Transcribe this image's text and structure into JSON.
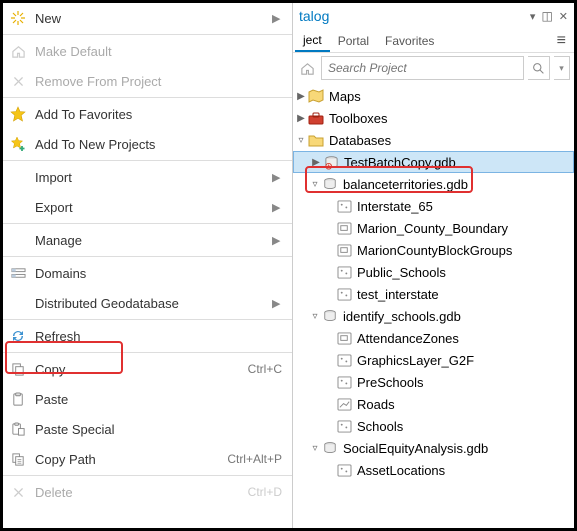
{
  "context_menu": {
    "new": "New",
    "make_default": "Make Default",
    "remove": "Remove From Project",
    "add_fav": "Add To Favorites",
    "add_newproj": "Add To New Projects",
    "import": "Import",
    "export": "Export",
    "manage": "Manage",
    "domains": "Domains",
    "dist_gdb": "Distributed Geodatabase",
    "refresh": "Refresh",
    "copy": "Copy",
    "copy_sc": "Ctrl+C",
    "paste": "Paste",
    "paste_special": "Paste Special",
    "copy_path": "Copy Path",
    "copy_path_sc": "Ctrl+Alt+P",
    "delete": "Delete",
    "delete_sc": "Ctrl+D"
  },
  "catalog": {
    "title": "talog",
    "tabs": {
      "project": "ject",
      "portal": "Portal",
      "favorites": "Favorites"
    },
    "search_placeholder": "Search Project",
    "tree": {
      "maps": "Maps",
      "toolboxes": "Toolboxes",
      "databases": "Databases",
      "testbatch": "TestBatchCopy.gdb",
      "balance": "balanceterritories.gdb",
      "interstate65": "Interstate_65",
      "marion_boundary": "Marion_County_Boundary",
      "marion_blocks": "MarionCountyBlockGroups",
      "public_schools": "Public_Schools",
      "test_interstate": "test_interstate",
      "identify": "identify_schools.gdb",
      "attendance": "AttendanceZones",
      "graphics": "GraphicsLayer_G2F",
      "preschools": "PreSchools",
      "roads": "Roads",
      "schools": "Schools",
      "social": "SocialEquityAnalysis.gdb",
      "asset": "AssetLocations"
    }
  }
}
